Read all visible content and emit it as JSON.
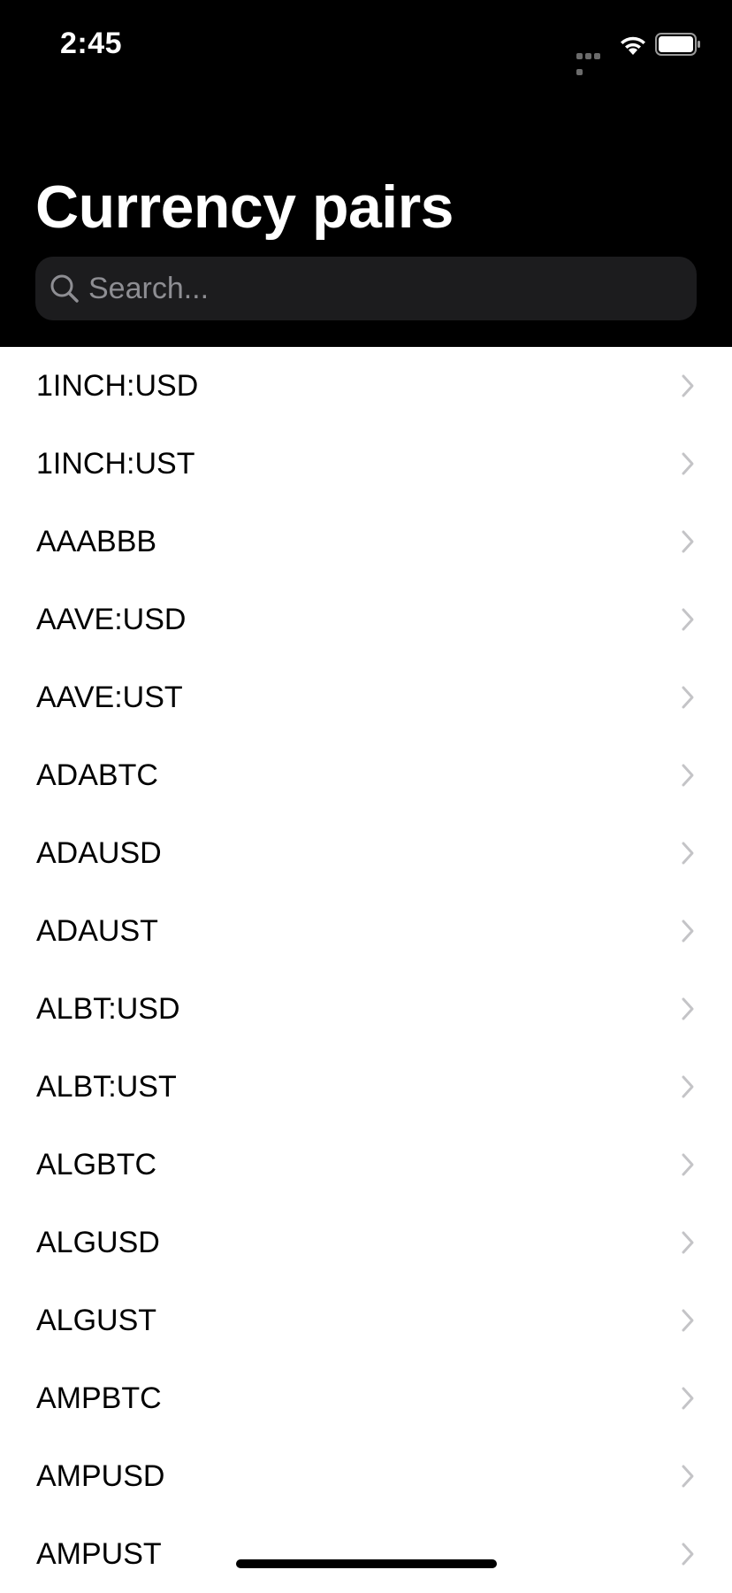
{
  "status_bar": {
    "time": "2:45"
  },
  "header": {
    "title": "Currency pairs"
  },
  "search": {
    "placeholder": "Search...",
    "value": ""
  },
  "colors": {
    "header_background": "#000000",
    "search_background": "#1c1c1e",
    "placeholder": "#8e8e93",
    "chevron": "#c4c4c7",
    "list_background": "#ffffff"
  },
  "pairs": [
    "1INCH:USD",
    "1INCH:UST",
    "AAABBB",
    "AAVE:USD",
    "AAVE:UST",
    "ADABTC",
    "ADAUSD",
    "ADAUST",
    "ALBT:USD",
    "ALBT:UST",
    "ALGBTC",
    "ALGUSD",
    "ALGUST",
    "AMPBTC",
    "AMPUSD",
    "AMPUST"
  ]
}
